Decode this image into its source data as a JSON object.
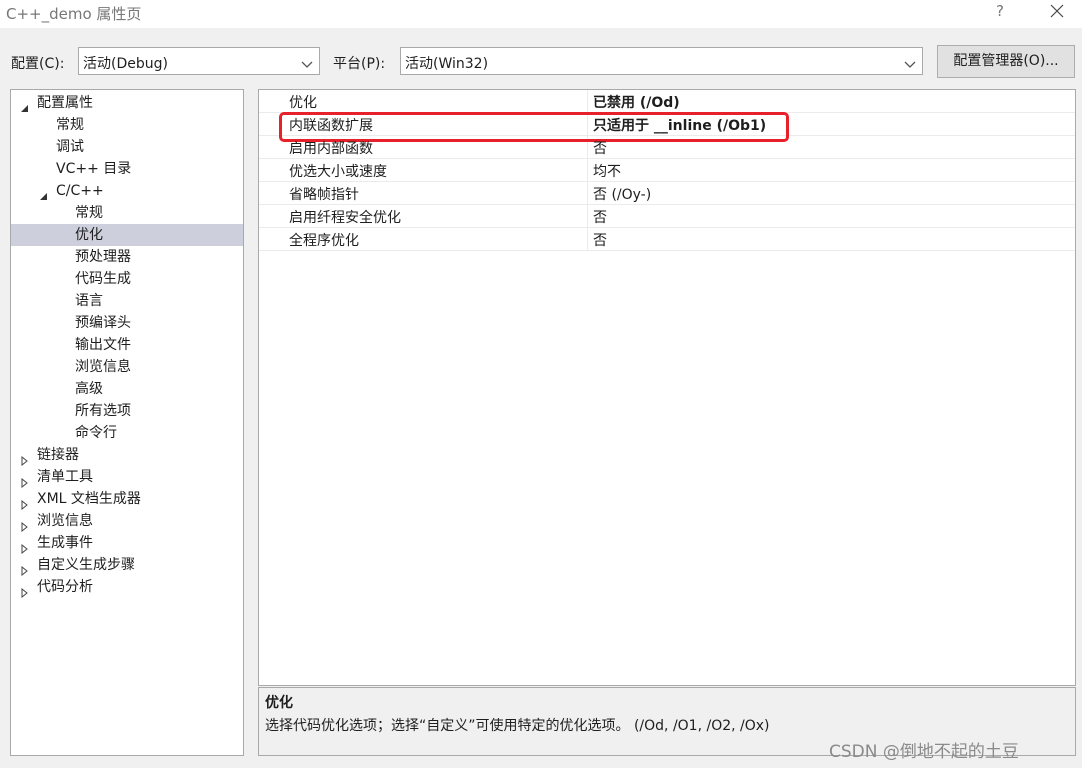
{
  "window": {
    "title": "C++_demo 属性页",
    "help_label": "?"
  },
  "toolbar": {
    "config_label": "配置(C):",
    "config_value": "活动(Debug)",
    "platform_label": "平台(P):",
    "platform_value": "活动(Win32)",
    "manager_button": "配置管理器(O)..."
  },
  "tree": {
    "items": [
      {
        "label": "配置属性",
        "level": 0,
        "arrow": "expanded"
      },
      {
        "label": "常规",
        "level": 1,
        "arrow": "none"
      },
      {
        "label": "调试",
        "level": 1,
        "arrow": "none"
      },
      {
        "label": "VC++ 目录",
        "level": 1,
        "arrow": "none"
      },
      {
        "label": "C/C++",
        "level": 1,
        "arrow": "expanded"
      },
      {
        "label": "常规",
        "level": 2,
        "arrow": "none"
      },
      {
        "label": "优化",
        "level": 2,
        "arrow": "none",
        "selected": true
      },
      {
        "label": "预处理器",
        "level": 2,
        "arrow": "none"
      },
      {
        "label": "代码生成",
        "level": 2,
        "arrow": "none"
      },
      {
        "label": "语言",
        "level": 2,
        "arrow": "none"
      },
      {
        "label": "预编译头",
        "level": 2,
        "arrow": "none"
      },
      {
        "label": "输出文件",
        "level": 2,
        "arrow": "none"
      },
      {
        "label": "浏览信息",
        "level": 2,
        "arrow": "none"
      },
      {
        "label": "高级",
        "level": 2,
        "arrow": "none"
      },
      {
        "label": "所有选项",
        "level": 2,
        "arrow": "none"
      },
      {
        "label": "命令行",
        "level": 2,
        "arrow": "none"
      },
      {
        "label": "链接器",
        "level": 0,
        "arrow": "collapsed"
      },
      {
        "label": "清单工具",
        "level": 0,
        "arrow": "collapsed"
      },
      {
        "label": "XML 文档生成器",
        "level": 0,
        "arrow": "collapsed"
      },
      {
        "label": "浏览信息",
        "level": 0,
        "arrow": "collapsed"
      },
      {
        "label": "生成事件",
        "level": 0,
        "arrow": "collapsed"
      },
      {
        "label": "自定义生成步骤",
        "level": 0,
        "arrow": "collapsed"
      },
      {
        "label": "代码分析",
        "level": 0,
        "arrow": "collapsed"
      }
    ]
  },
  "grid": {
    "rows": [
      {
        "name": "优化",
        "value": "已禁用 (/Od)",
        "bold": true
      },
      {
        "name": "内联函数扩展",
        "value": "只适用于 __inline (/Ob1)",
        "bold": true,
        "highlighted": true
      },
      {
        "name": "启用内部函数",
        "value": "否",
        "bold": false
      },
      {
        "name": "优选大小或速度",
        "value": "均不",
        "bold": false
      },
      {
        "name": "省略帧指针",
        "value": "否 (/Oy-)",
        "bold": false
      },
      {
        "name": "启用纤程安全优化",
        "value": "否",
        "bold": false
      },
      {
        "name": "全程序优化",
        "value": "否",
        "bold": false
      }
    ]
  },
  "description": {
    "title": "优化",
    "text": "选择代码优化选项；选择“自定义”可使用特定的优化选项。     (/Od, /O1, /O2, /Ox)"
  },
  "watermark": "CSDN @倒地不起的土豆",
  "colors": {
    "highlight_border": "#e8202a",
    "selected_bg": "#cdd0dc"
  }
}
